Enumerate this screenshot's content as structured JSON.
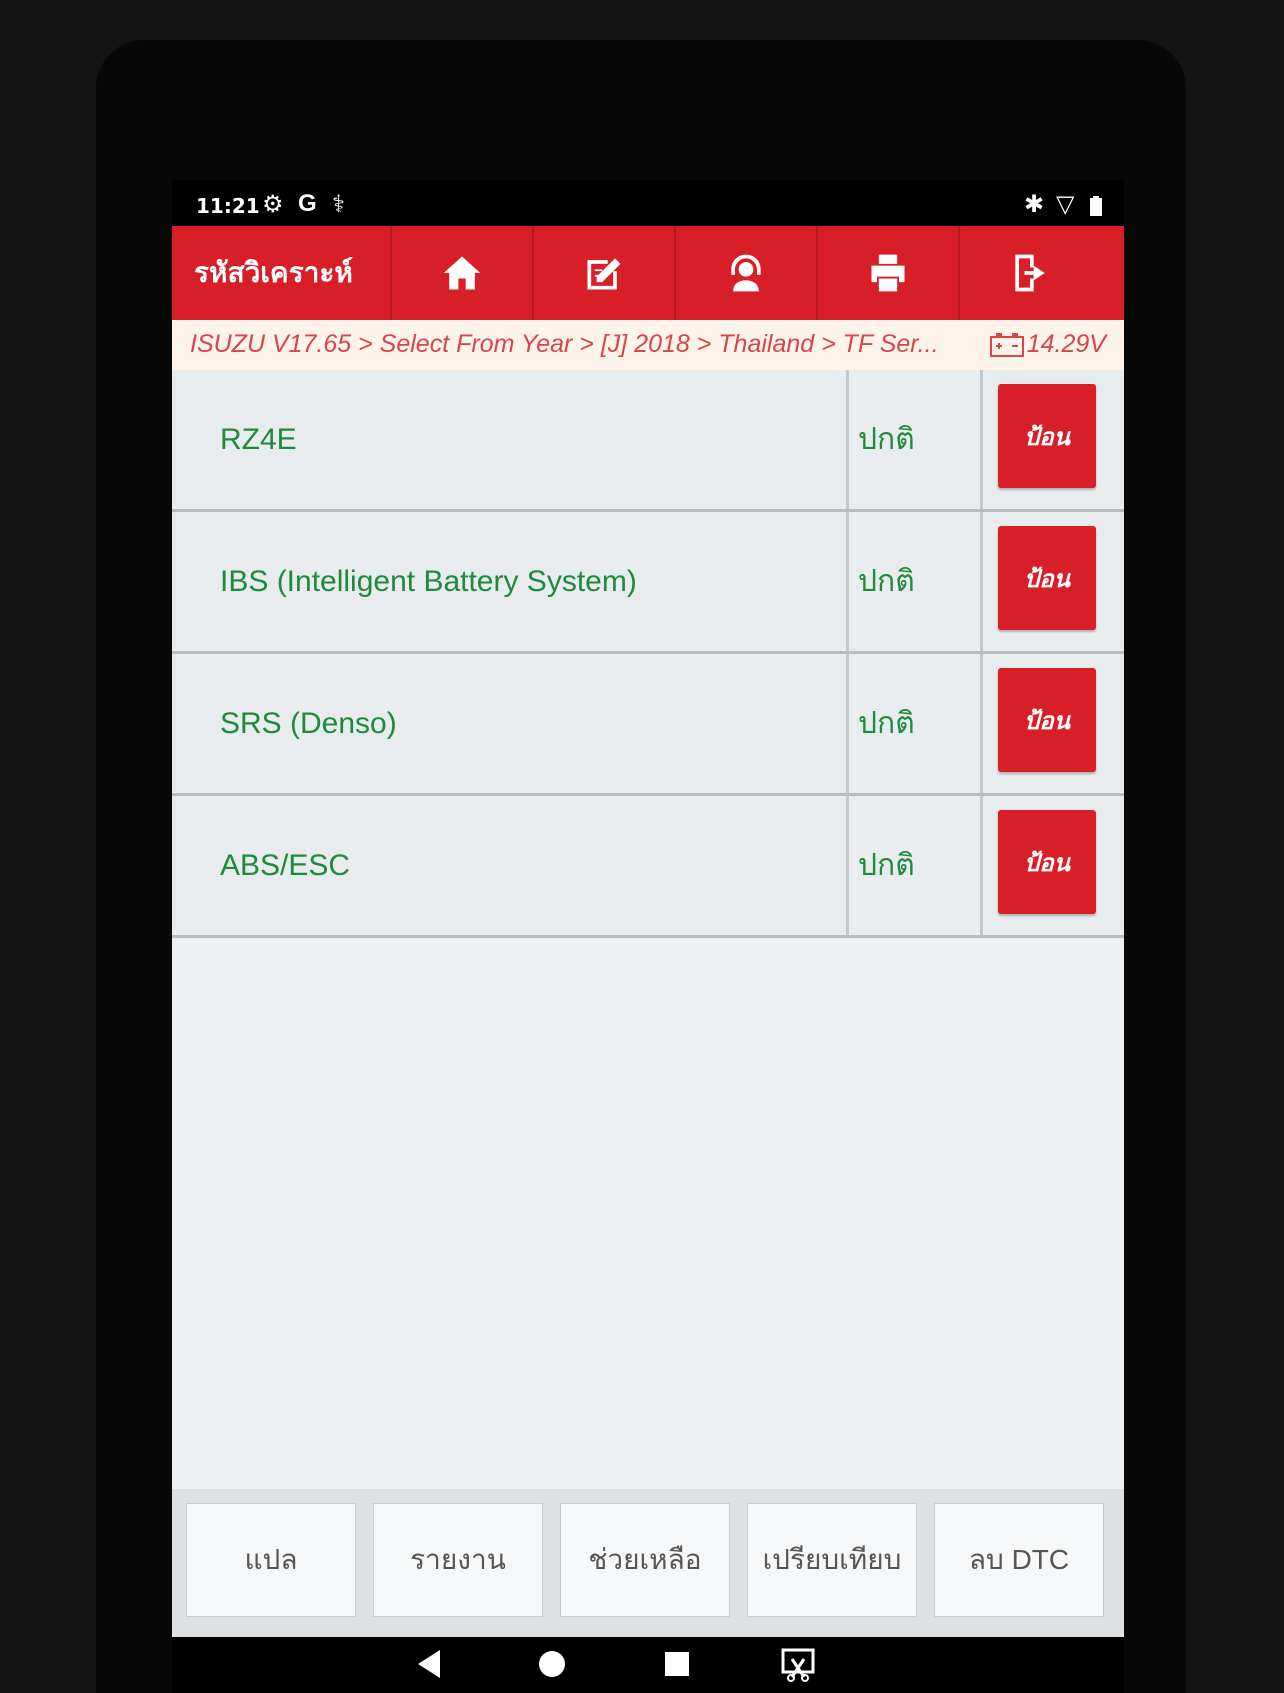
{
  "status_bar": {
    "time": "11:21",
    "icons_left": [
      "settings-gear-icon",
      "google-icon",
      "usb-debug-icon"
    ],
    "icons_right": [
      "bluetooth-icon",
      "wifi-icon",
      "battery-icon"
    ]
  },
  "header": {
    "title": "รหัสวิเคราะห์",
    "buttons": [
      "home-icon",
      "edit-icon",
      "support-agent-icon",
      "print-icon",
      "exit-icon"
    ],
    "accent_color": "#d81e26"
  },
  "breadcrumb": {
    "path": "ISUZU V17.65 > Select From Year > [J] 2018 > Thailand > TF Ser...",
    "voltage": "14.29V"
  },
  "systems": [
    {
      "name": "RZ4E",
      "status": "ปกติ",
      "action": "ป้อน"
    },
    {
      "name": "IBS (Intelligent Battery System)",
      "status": "ปกติ",
      "action": "ป้อน"
    },
    {
      "name": "SRS (Denso)",
      "status": "ปกติ",
      "action": "ป้อน"
    },
    {
      "name": "ABS/ESC",
      "status": "ปกติ",
      "action": "ป้อน"
    }
  ],
  "toolbar": {
    "translate": "แปล",
    "report": "รายงาน",
    "help": "ช่วยเหลือ",
    "compare": "เปรียบเทียบ",
    "clear_dtc": "ลบ DTC"
  },
  "navbar": [
    "back-icon",
    "home-circle-icon",
    "recents-icon",
    "screenshot-icon"
  ]
}
